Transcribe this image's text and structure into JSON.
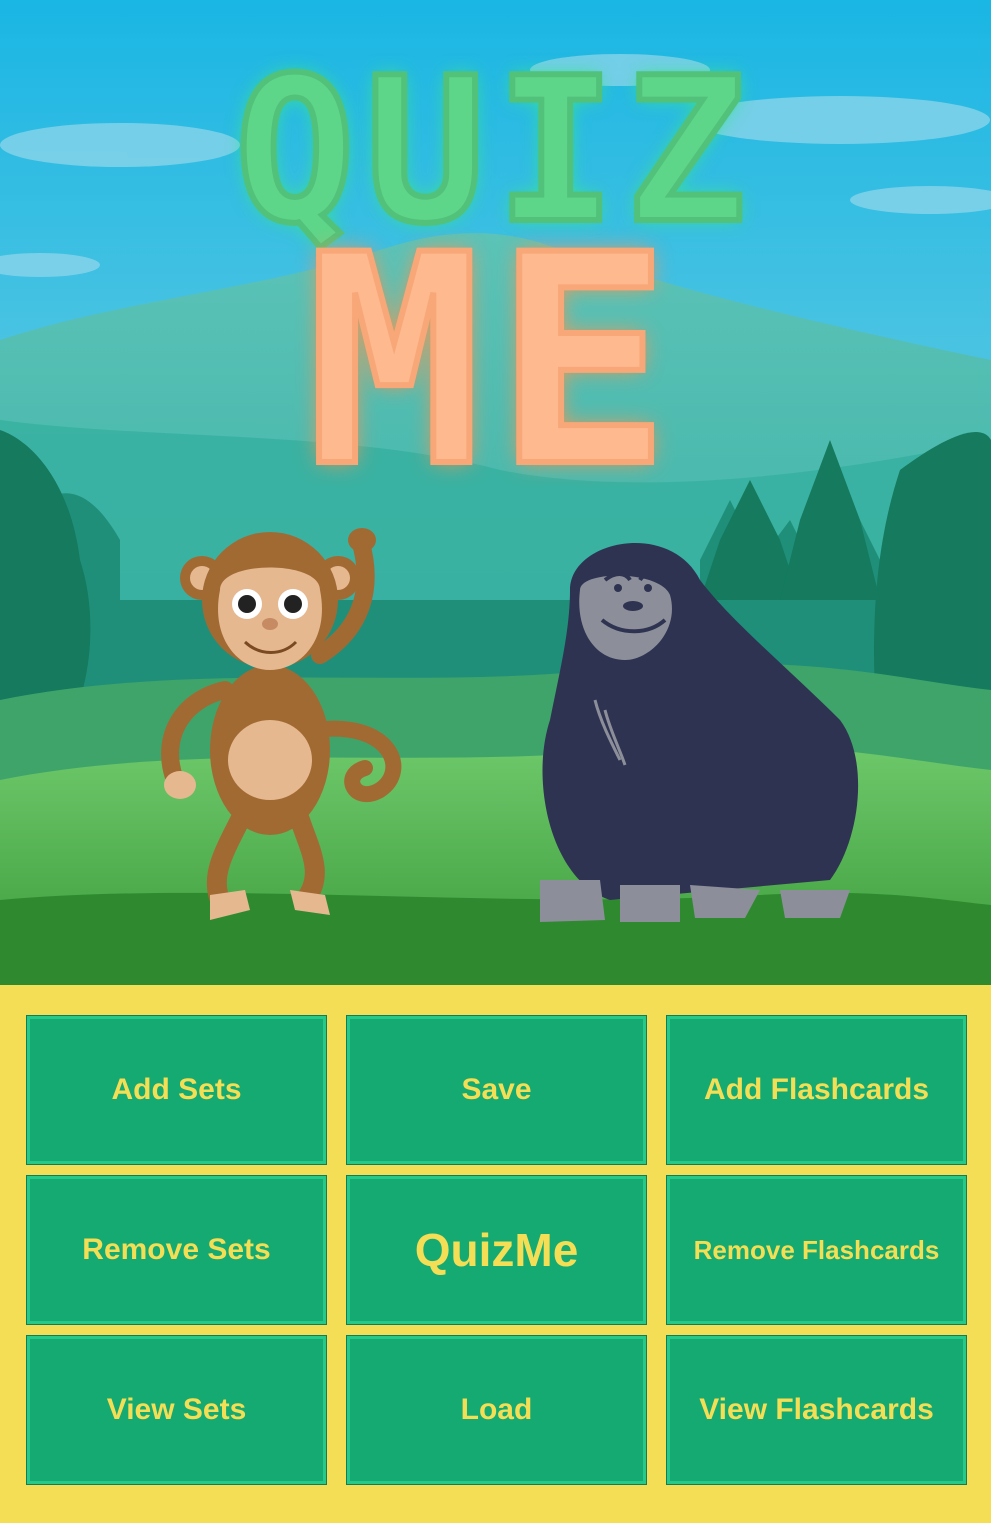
{
  "title": {
    "line1": "QUIZ",
    "line2": "ME"
  },
  "menu": {
    "add_sets": "Add Sets",
    "save": "Save",
    "add_flashcards": "Add Flashcards",
    "remove_sets": "Remove Sets",
    "quizme": "QuizMe",
    "remove_flashcards": "Remove Flashcards",
    "view_sets": "View Sets",
    "load": "Load",
    "view_flashcards": "View Flashcards"
  },
  "colors": {
    "panel_background": "#f3de55",
    "button_fill": "#14aa71",
    "button_text": "#f3de55",
    "title_quiz": "#5ed68a",
    "title_me": "#ffb98f"
  },
  "illustration": {
    "characters": [
      "monkey",
      "gorilla"
    ],
    "scene": "jungle-mountain-background"
  }
}
